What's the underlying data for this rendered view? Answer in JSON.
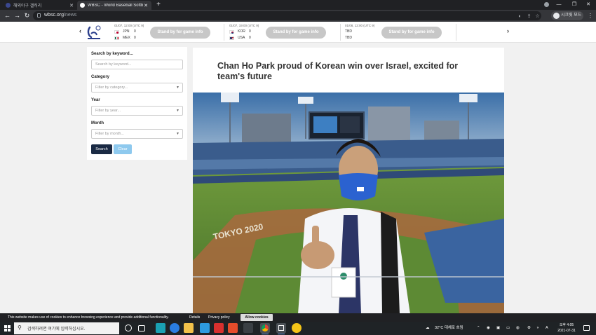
{
  "browser": {
    "tabs": [
      {
        "title": "해외야구 갤러리",
        "favicon_color": "#3b4890"
      },
      {
        "title": "WBSC - World Baseball Softb",
        "favicon_color": "#1e88e5"
      }
    ],
    "url_domain": "wbsc.org",
    "url_path": "/news",
    "profile_label": "시크릿 모드"
  },
  "ticker": {
    "games": [
      {
        "date": "01/07, 12:00 (UTC 9)",
        "team1": "JPN",
        "score1": "0",
        "flag1": "jpn",
        "team2": "MEX",
        "score2": "0",
        "flag2": "mex",
        "button": "Stand by for game info"
      },
      {
        "date": "01/07, 19:00 (UTC 9)",
        "team1": "KOR",
        "score1": "0",
        "flag1": "kor",
        "team2": "USA",
        "score2": "0",
        "flag2": "usa",
        "button": "Stand by for game info"
      },
      {
        "date": "01/08, 12:00 (UTC 9)",
        "team1": "TBD",
        "score1": "",
        "flag1": "none",
        "team2": "TBD",
        "score2": "",
        "flag2": "none",
        "button": "Stand by for game info"
      }
    ]
  },
  "filters": {
    "keyword_label": "Search by keyword...",
    "keyword_placeholder": "Search by keyword...",
    "category_label": "Category",
    "category_placeholder": "Filter by category...",
    "year_label": "Year",
    "year_placeholder": "Filter by year...",
    "month_label": "Month",
    "month_placeholder": "Filter by month...",
    "search_button": "Search",
    "clear_button": "Clear"
  },
  "article": {
    "headline": "Chan Ho Park proud of Korean win over Israel, excited for team's future",
    "photo_field_text": "TOKYO 2020"
  },
  "cookie_banner": {
    "message": "This website makes use of cookies to enhance browsing experience and provide additional functionality.",
    "details_link": "Details",
    "privacy_link": "Privacy policy",
    "allow_button": "Allow cookies"
  },
  "taskbar": {
    "search_placeholder": "검색하려면 여기에 입력하십시오.",
    "weather": "32°C  대체로 흐림",
    "time": "오후 4:05",
    "date": "2021-07-31"
  }
}
